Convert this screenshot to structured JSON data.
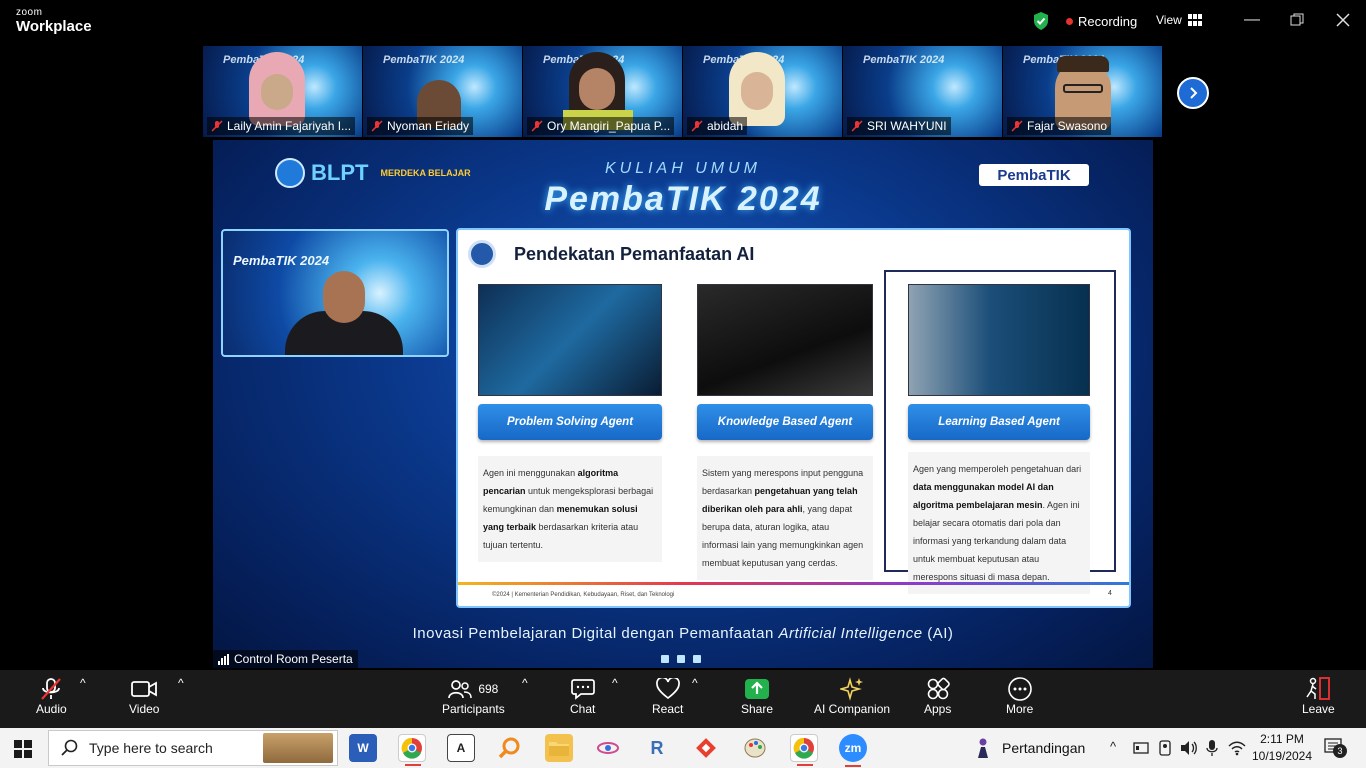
{
  "app": {
    "brand_small": "zoom",
    "brand_big": "Workplace",
    "recording_label": "Recording",
    "view_label": "View"
  },
  "participants_strip": [
    {
      "name": "Laily Amin Fajariyah I...",
      "face": "#c9a98a",
      "hijab": "#e9a9b4"
    },
    {
      "name": "Nyoman Eriady",
      "face": "#6b4a36",
      "hijab": ""
    },
    {
      "name": "Ory Mangiri_Papua P...",
      "face": "#b58466",
      "hijab": ""
    },
    {
      "name": "abidah",
      "face": "#d9b497",
      "hijab": "#f2e7c6"
    },
    {
      "name": "SRI WAHYUNI",
      "face": "",
      "hijab": ""
    },
    {
      "name": "Fajar Swasono",
      "face": "#c59a75",
      "hijab": ""
    }
  ],
  "share": {
    "blpt": "BLPT",
    "merdeka": "MERDEKA BELAJAR",
    "kuliah": "KULIAH UMUM",
    "title": "PembaTIK 2024",
    "pembatik_logo": "PembaTIK",
    "presenter_title": "PembaTIK 2024",
    "slide": {
      "title": "Pendekatan Pemanfaatan AI",
      "cards": [
        {
          "label": "Problem Solving Agent",
          "desc_parts": [
            "Agen ini menggunakan ",
            "algoritma pencarian",
            " untuk mengeksplorasi berbagai kemungkinan dan ",
            "menemukan solusi yang terbaik",
            " berdasarkan kriteria atau tujuan tertentu."
          ]
        },
        {
          "label": "Knowledge Based Agent",
          "desc_parts": [
            "Sistem yang merespons input pengguna berdasarkan ",
            "pengetahuan yang telah diberikan oleh para ahli",
            ", yang dapat berupa data, aturan logika, atau informasi lain yang memungkinkan agen membuat keputusan yang cerdas."
          ]
        },
        {
          "label": "Learning Based Agent",
          "desc_parts": [
            "Agen yang memperoleh pengetahuan dari ",
            "data menggunakan model AI dan algoritma pembelajaran mesin",
            ". Agen ini belajar secara otomatis dari pola dan informasi yang terkandung dalam data untuk membuat keputusan atau merespons situasi di masa depan."
          ]
        }
      ],
      "footer": "©2024 | Kementerian Pendidikan, Kebudayaan, Riset, dan Teknologi",
      "page_number": "4"
    },
    "caption_main": "Inovasi Pembelajaran Digital dengan Pemanfaatan ",
    "caption_italic": "Artificial Intelligence",
    "caption_end": " (AI)",
    "share_label": "Control Room Peserta"
  },
  "toolbar": {
    "audio": "Audio",
    "video": "Video",
    "participants": "Participants",
    "participants_count": "698",
    "chat": "Chat",
    "react": "React",
    "share": "Share",
    "ai_companion": "AI Companion",
    "apps": "Apps",
    "more": "More",
    "leave": "Leave"
  },
  "taskbar": {
    "search_placeholder": "Type here to search",
    "weather": "Pertandingan",
    "time": "2:11 PM",
    "date": "10/19/2024",
    "notification_count": "3"
  }
}
